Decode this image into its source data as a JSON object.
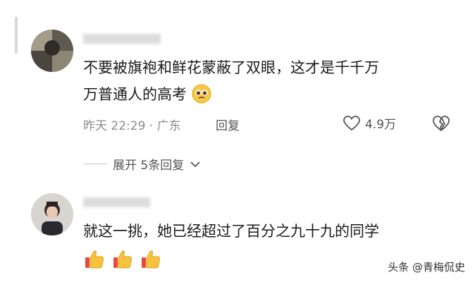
{
  "comments": [
    {
      "text_line1": "不要被旗袍和鲜花蒙蔽了双眼，这才是千千万",
      "text_line2": "万普通人的高考",
      "time": "昨天 22:29 · 广东",
      "reply": "回复",
      "likes": "4.9万",
      "emoji": "pleading-face"
    },
    {
      "text_line1": "就这一挑，她已经超过了百分之九十九的同学",
      "emoji": "thumbs-up x3"
    }
  ],
  "expand": {
    "label": "展开 5条回复"
  },
  "watermark": "头条 @青梅侃史",
  "colors": {
    "text": "#1b1b1b",
    "meta": "#8a8a8a",
    "background": "#ffffff"
  }
}
